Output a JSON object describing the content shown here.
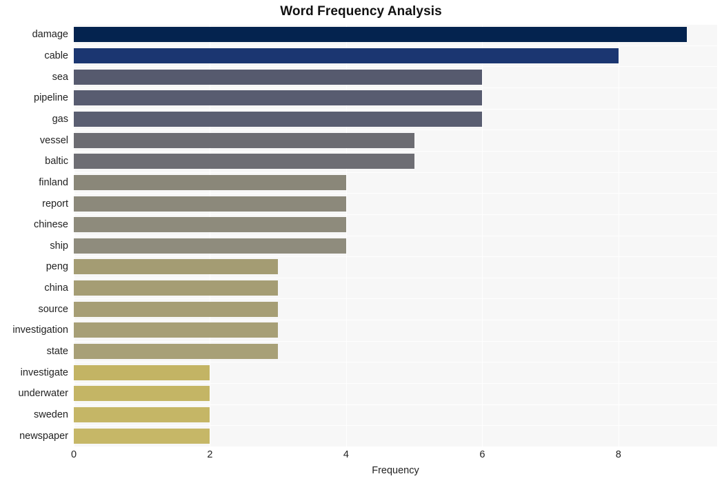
{
  "chart_data": {
    "type": "bar",
    "orientation": "horizontal",
    "title": "Word Frequency Analysis",
    "xlabel": "Frequency",
    "ylabel": "",
    "xlim": [
      0,
      9.45
    ],
    "ylim": null,
    "grid": true,
    "legend": null,
    "xticks": [
      "0",
      "2",
      "4",
      "6",
      "8"
    ],
    "xtick_values": [
      0,
      2,
      4,
      6,
      8
    ],
    "categories": [
      "damage",
      "cable",
      "sea",
      "pipeline",
      "gas",
      "vessel",
      "baltic",
      "finland",
      "report",
      "chinese",
      "ship",
      "peng",
      "china",
      "source",
      "investigation",
      "state",
      "investigate",
      "underwater",
      "sweden",
      "newspaper"
    ],
    "values": [
      9,
      8,
      6,
      6,
      6,
      5,
      5,
      4,
      4,
      4,
      4,
      3,
      3,
      3,
      3,
      3,
      2,
      2,
      2,
      2
    ],
    "bar_colors": [
      "#04234f",
      "#1b3671",
      "#565a6e",
      "#585c70",
      "#5a5e71",
      "#6c6c72",
      "#6e6e74",
      "#8a8779",
      "#8c897b",
      "#8e8b7c",
      "#8f8c7d",
      "#a49c73",
      "#a59d74",
      "#a69e75",
      "#a79f76",
      "#a8a077",
      "#c3b464",
      "#c4b565",
      "#c5b666",
      "#c6b767"
    ],
    "plot_background": "#f7f7f7",
    "grid_color": "#ffffff",
    "figure_background": "#ffffff",
    "text_color": "#222222",
    "title_color": "#111111"
  }
}
